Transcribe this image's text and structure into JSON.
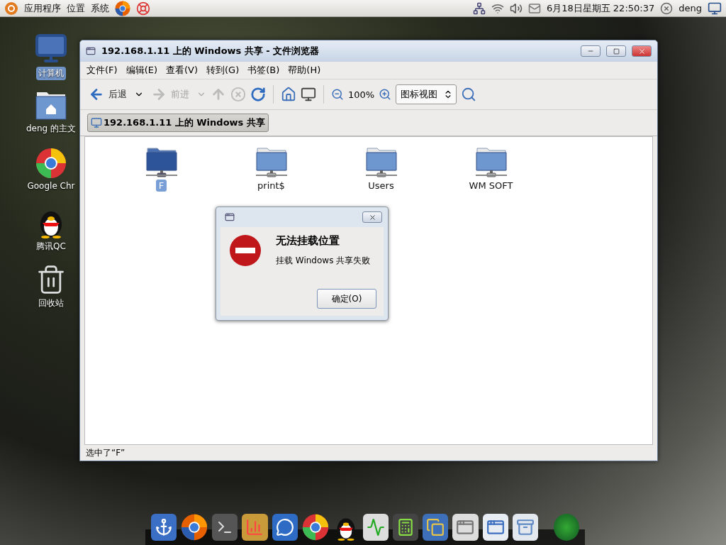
{
  "top_panel": {
    "menus": [
      "应用程序",
      "位置",
      "系统"
    ],
    "clock": "6月18日星期五 22:50:37",
    "user": "deng"
  },
  "desktop_icons": [
    {
      "kind": "computer",
      "label": "计算机",
      "selected": true
    },
    {
      "kind": "home",
      "label": "deng 的主文",
      "selected": false
    },
    {
      "kind": "chrome",
      "label": "Google Chr",
      "selected": false
    },
    {
      "kind": "qq",
      "label": "腾讯QC",
      "selected": false
    },
    {
      "kind": "trash",
      "label": "回收站",
      "selected": false
    }
  ],
  "window": {
    "title": "192.168.1.11 上的 Windows 共享 - 文件浏览器",
    "menu": [
      "文件(F)",
      "编辑(E)",
      "查看(V)",
      "转到(G)",
      "书签(B)",
      "帮助(H)"
    ],
    "toolbar": {
      "back": {
        "label": "后退",
        "disabled": false
      },
      "forward": {
        "label": "前进",
        "disabled": true
      },
      "zoom": "100%",
      "view": "图标视图"
    },
    "location": "192.168.1.11 上的 Windows 共享",
    "files": [
      {
        "name": "F",
        "selected": true
      },
      {
        "name": "print$",
        "selected": false
      },
      {
        "name": "Users",
        "selected": false
      },
      {
        "name": "WM SOFT",
        "selected": false
      }
    ],
    "status": "选中了“F”"
  },
  "dialog": {
    "heading": "无法挂载位置",
    "message": "挂载 Windows 共享失败",
    "button": "确定(O)"
  }
}
